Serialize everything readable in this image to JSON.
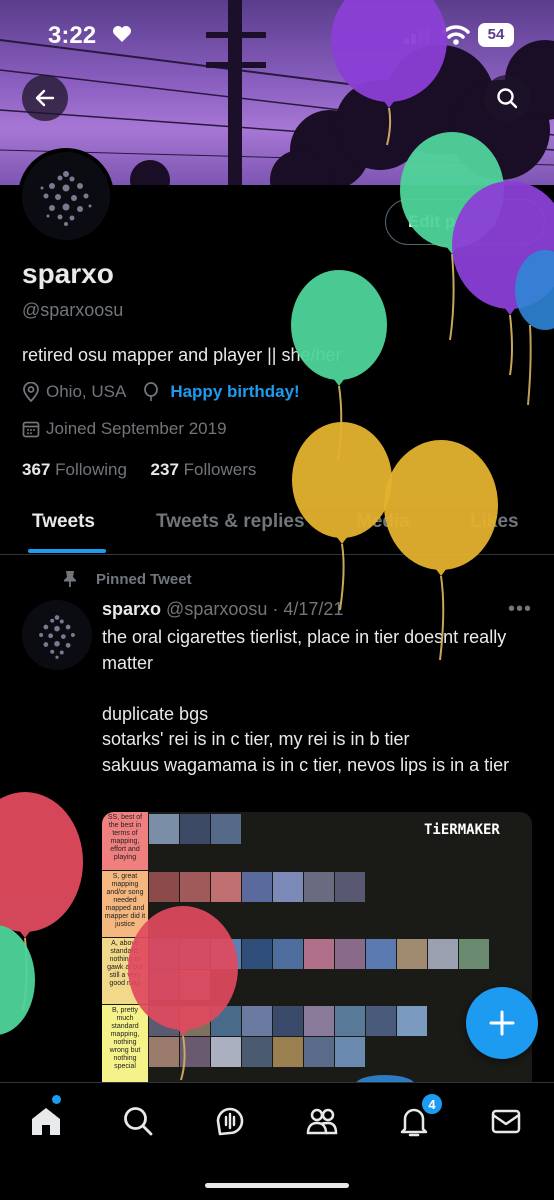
{
  "status": {
    "time": "3:22",
    "battery": "54"
  },
  "profile": {
    "edit_label": "Edit profile",
    "name": "sparxo",
    "handle": "@sparxoosu",
    "bio": "retired osu mapper and player || she/her",
    "location": "Ohio, USA",
    "birthday": "Happy birthday!",
    "joined": "Joined September 2019",
    "following_count": "367",
    "following_label": "Following",
    "followers_count": "237",
    "followers_label": "Followers"
  },
  "tabs": [
    {
      "label": "Tweets"
    },
    {
      "label": "Tweets & replies"
    },
    {
      "label": "Media"
    },
    {
      "label": "Likes"
    }
  ],
  "tweet": {
    "pinned_label": "Pinned Tweet",
    "author": "sparxo",
    "meta": "@sparxoosu · 4/17/21",
    "body": "the oral cigarettes tierlist, place in tier doesnt really matter\n\nduplicate bgs\nsotarks' rei is in c tier, my rei is in b tier\nsakuus wagamama is in c tier, nevos lips is in a tier",
    "tiers": [
      {
        "label": "SS, best of the best in terms of mapping, effort and playing",
        "color": "#f08080"
      },
      {
        "label": "S, great mapping and/or song needed mapped and mapper did it justice",
        "color": "#f4b77f"
      },
      {
        "label": "A, above standard, nothing to gawk at but still a very good map",
        "color": "#f2d98a"
      },
      {
        "label": "B, pretty much standard mapping, nothing wrong but nothing special",
        "color": "#f5f28a"
      }
    ],
    "tiermaker_label": "TiERMAKER"
  },
  "nav": {
    "notification_count": "4",
    "icons": [
      "home-icon",
      "search-icon",
      "spaces-icon",
      "communities-icon",
      "notifications-icon",
      "messages-icon"
    ]
  },
  "colors": {
    "accent": "#1d9bf0",
    "background": "#000000",
    "text": "#e7e9ea",
    "muted": "#71767b"
  }
}
